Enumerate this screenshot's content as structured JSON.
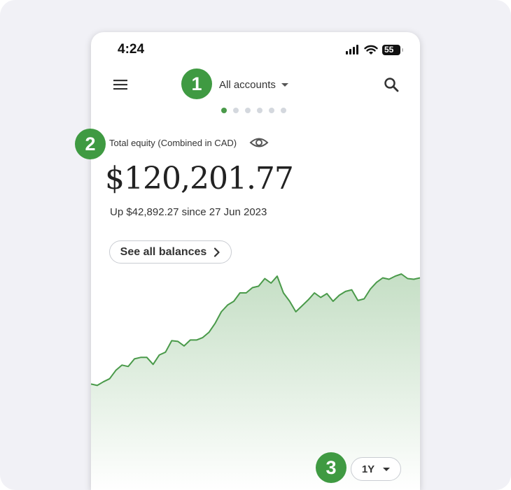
{
  "status_bar": {
    "time": "4:24",
    "battery": "55"
  },
  "header": {
    "account_selector": "All accounts",
    "page_dots": 6,
    "active_dot": 0
  },
  "summary": {
    "label": "Total equity (Combined in CAD)",
    "amount": "$120,201.77",
    "change": "Up $42,892.27 since 27 Jun 2023",
    "balances_button": "See all balances"
  },
  "range": {
    "selected": "1Y"
  },
  "callouts": [
    "1",
    "2",
    "3"
  ],
  "colors": {
    "accent": "#3f9a42",
    "line": "#4a9a4a"
  },
  "chart_data": {
    "type": "area",
    "title": "",
    "xlabel": "",
    "ylabel": "",
    "grid": false,
    "ylim": [
      0,
      100
    ],
    "values": [
      58.1,
      57.5,
      59.0,
      60.3,
      63.8,
      66.0,
      65.4,
      68.6,
      69.2,
      69.2,
      66.3,
      70.2,
      71.4,
      76.2,
      75.9,
      74.0,
      76.5,
      76.5,
      77.5,
      79.7,
      83.5,
      88.3,
      91.1,
      92.7,
      96.2,
      96.2,
      98.4,
      99.0,
      102.2,
      100.3,
      103.2,
      96.2,
      92.7,
      88.3,
      90.8,
      93.3,
      96.2,
      94.3,
      95.9,
      92.7,
      95.2,
      96.8,
      97.5,
      93.0,
      93.7,
      97.8,
      100.6,
      102.5,
      101.9,
      103.2,
      104.1,
      102.2,
      101.9,
      102.5
    ]
  }
}
